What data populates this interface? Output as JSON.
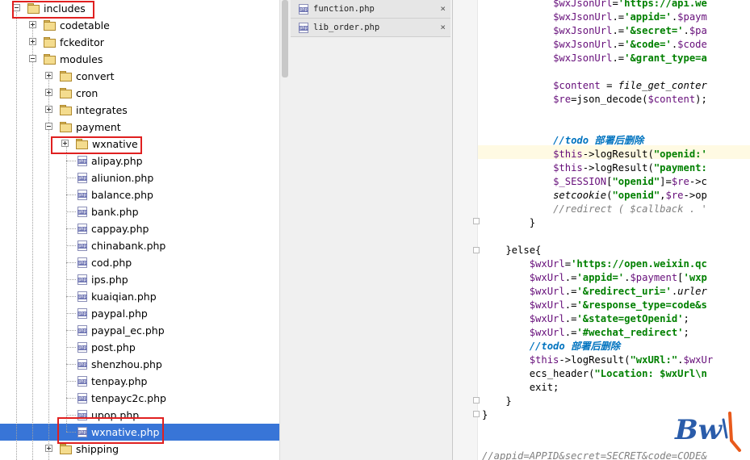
{
  "tree": {
    "nodes": [
      {
        "label": "includes",
        "type": "folder",
        "expander": "minus"
      },
      {
        "label": "codetable",
        "type": "folder",
        "expander": "plus"
      },
      {
        "label": "fckeditor",
        "type": "folder",
        "expander": "plus"
      },
      {
        "label": "modules",
        "type": "folder",
        "expander": "minus"
      },
      {
        "label": "convert",
        "type": "folder",
        "expander": "plus"
      },
      {
        "label": "cron",
        "type": "folder",
        "expander": "plus"
      },
      {
        "label": "integrates",
        "type": "folder",
        "expander": "plus"
      },
      {
        "label": "payment",
        "type": "folder",
        "expander": "minus"
      },
      {
        "label": "wxnative",
        "type": "folder",
        "expander": "plus"
      },
      {
        "label": "alipay.php",
        "type": "php"
      },
      {
        "label": "aliunion.php",
        "type": "php"
      },
      {
        "label": "balance.php",
        "type": "php"
      },
      {
        "label": "bank.php",
        "type": "php"
      },
      {
        "label": "cappay.php",
        "type": "php"
      },
      {
        "label": "chinabank.php",
        "type": "php"
      },
      {
        "label": "cod.php",
        "type": "php"
      },
      {
        "label": "ips.php",
        "type": "php"
      },
      {
        "label": "kuaiqian.php",
        "type": "php"
      },
      {
        "label": "paypal.php",
        "type": "php"
      },
      {
        "label": "paypal_ec.php",
        "type": "php"
      },
      {
        "label": "post.php",
        "type": "php"
      },
      {
        "label": "shenzhou.php",
        "type": "php"
      },
      {
        "label": "tenpay.php",
        "type": "php"
      },
      {
        "label": "tenpayc2c.php",
        "type": "php"
      },
      {
        "label": "upop.php",
        "type": "php"
      },
      {
        "label": "wxnative.php",
        "type": "php",
        "selected": true
      },
      {
        "label": "shipping",
        "type": "folder",
        "expander": "plus"
      }
    ],
    "selection_color": "#3875d7",
    "highlight_box_color": "#e02020"
  },
  "tabs": [
    {
      "label": "function.php",
      "icon": "php-file-icon",
      "close": "×"
    },
    {
      "label": "lib_order.php",
      "icon": "php-file-icon",
      "close": "×"
    }
  ],
  "editor": {
    "lines": [
      [
        [
          "            ",
          ""
        ],
        [
          "$wxJsonUrl",
          "var"
        ],
        [
          "=",
          ""
        ],
        [
          "'https://api.we",
          "str"
        ]
      ],
      [
        [
          "            ",
          ""
        ],
        [
          "$wxJsonUrl",
          "var"
        ],
        [
          ".=",
          ""
        ],
        [
          "'appid='",
          "str"
        ],
        [
          ".",
          ""
        ],
        [
          "$paym",
          "var"
        ]
      ],
      [
        [
          "            ",
          ""
        ],
        [
          "$wxJsonUrl",
          "var"
        ],
        [
          ".=",
          ""
        ],
        [
          "'&secret='",
          "str"
        ],
        [
          ".",
          ""
        ],
        [
          "$pa",
          "var"
        ]
      ],
      [
        [
          "            ",
          ""
        ],
        [
          "$wxJsonUrl",
          "var"
        ],
        [
          ".=",
          ""
        ],
        [
          "'&code='",
          "str"
        ],
        [
          ".",
          ""
        ],
        [
          "$code",
          "var"
        ]
      ],
      [
        [
          "            ",
          ""
        ],
        [
          "$wxJsonUrl",
          "var"
        ],
        [
          ".=",
          ""
        ],
        [
          "'&grant_type=a",
          "str"
        ]
      ],
      [
        [
          "",
          ""
        ]
      ],
      [
        [
          "            ",
          ""
        ],
        [
          "$content",
          "var"
        ],
        [
          " = ",
          ""
        ],
        [
          "file_get_conter",
          "fn"
        ]
      ],
      [
        [
          "            ",
          ""
        ],
        [
          "$re",
          "var"
        ],
        [
          "=json_decode(",
          ""
        ],
        [
          "$content",
          "var"
        ],
        [
          ");",
          ""
        ]
      ],
      [
        [
          "",
          ""
        ]
      ],
      [
        [
          "",
          ""
        ]
      ],
      [
        [
          "            ",
          ""
        ],
        [
          "//todo 部署后删除",
          "tdo"
        ]
      ],
      [
        [
          "            ",
          ""
        ],
        [
          "$this",
          "var"
        ],
        [
          "->logResult(",
          ""
        ],
        [
          "\"openid:'",
          "str"
        ]
      ],
      [
        [
          "            ",
          ""
        ],
        [
          "$this",
          "var"
        ],
        [
          "->logResult(",
          ""
        ],
        [
          "\"payment:",
          "str"
        ]
      ],
      [
        [
          "            ",
          ""
        ],
        [
          "$_SESSION",
          "var"
        ],
        [
          "[",
          ""
        ],
        [
          "\"openid\"",
          "str"
        ],
        [
          "]=",
          ""
        ],
        [
          "$re",
          "var"
        ],
        [
          "->c",
          ""
        ]
      ],
      [
        [
          "            ",
          ""
        ],
        [
          "setcookie",
          "fn"
        ],
        [
          "(",
          ""
        ],
        [
          "\"openid\"",
          "str"
        ],
        [
          ",",
          ""
        ],
        [
          "$re",
          "var"
        ],
        [
          "->op",
          ""
        ]
      ],
      [
        [
          "            ",
          ""
        ],
        [
          "//redirect ( $callback . '",
          "cmt"
        ]
      ],
      [
        [
          "        }",
          ""
        ]
      ],
      [
        [
          "",
          ""
        ]
      ],
      [
        [
          "    }else{",
          ""
        ]
      ],
      [
        [
          "        ",
          ""
        ],
        [
          "$wxUrl",
          "var"
        ],
        [
          "=",
          ""
        ],
        [
          "'https://open.weixin.qc",
          "str"
        ]
      ],
      [
        [
          "        ",
          ""
        ],
        [
          "$wxUrl",
          "var"
        ],
        [
          ".=",
          ""
        ],
        [
          "'appid='",
          "str"
        ],
        [
          ".",
          ""
        ],
        [
          "$payment",
          "var"
        ],
        [
          "[",
          ""
        ],
        [
          "'wxp",
          "str"
        ]
      ],
      [
        [
          "        ",
          ""
        ],
        [
          "$wxUrl",
          "var"
        ],
        [
          ".=",
          ""
        ],
        [
          "'&redirect_uri='",
          "str"
        ],
        [
          ".",
          ""
        ],
        [
          "urler",
          "fn"
        ]
      ],
      [
        [
          "        ",
          ""
        ],
        [
          "$wxUrl",
          "var"
        ],
        [
          ".=",
          ""
        ],
        [
          "'&response_type=code&s",
          "str"
        ]
      ],
      [
        [
          "        ",
          ""
        ],
        [
          "$wxUrl",
          "var"
        ],
        [
          ".=",
          ""
        ],
        [
          "'&state=getOpenid'",
          "str"
        ],
        [
          ";",
          ""
        ]
      ],
      [
        [
          "        ",
          ""
        ],
        [
          "$wxUrl",
          "var"
        ],
        [
          ".=",
          ""
        ],
        [
          "'#wechat_redirect'",
          "str"
        ],
        [
          ";",
          ""
        ]
      ],
      [
        [
          "        ",
          ""
        ],
        [
          "//todo 部署后删除",
          "tdo"
        ]
      ],
      [
        [
          "        ",
          ""
        ],
        [
          "$this",
          "var"
        ],
        [
          "->logResult(",
          ""
        ],
        [
          "\"wxURl:\"",
          "str"
        ],
        [
          ".",
          ""
        ],
        [
          "$wxUr",
          "var"
        ]
      ],
      [
        [
          "        ",
          ""
        ],
        [
          "ecs_header(",
          ""
        ],
        [
          "\"Location: $wxUrl\\n",
          "str"
        ]
      ],
      [
        [
          "        exit;",
          ""
        ]
      ],
      [
        [
          "    }",
          ""
        ]
      ],
      [
        [
          "}",
          ""
        ]
      ],
      [
        [
          "",
          ""
        ]
      ],
      [
        [
          "",
          ""
        ]
      ],
      [
        [
          "//appid=APPID&secret=SECRET&code=CODE&",
          "cmt"
        ]
      ]
    ]
  },
  "logo": {
    "text": "BwJ",
    "color_primary": "#2a5caa",
    "color_accent": "#e85a1c"
  }
}
